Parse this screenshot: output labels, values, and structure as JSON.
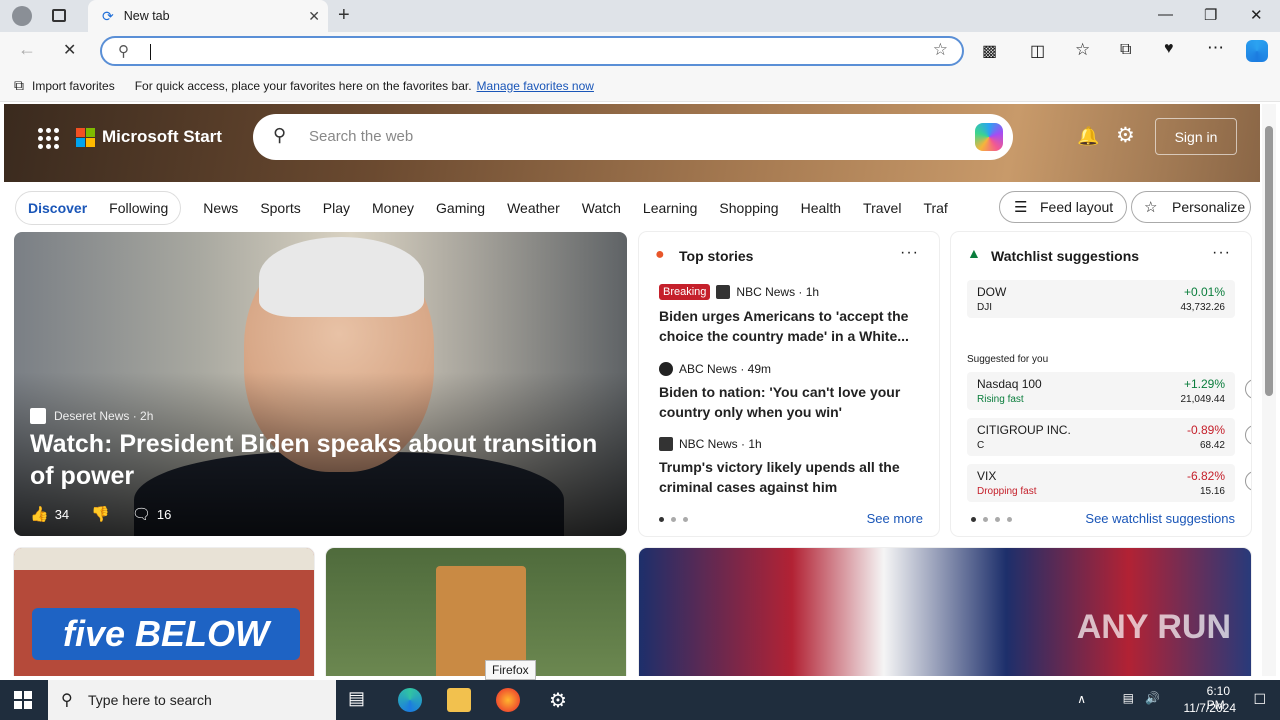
{
  "browser": {
    "tab_title": "New tab",
    "address_value": "",
    "fav_import": "Import favorites",
    "fav_hint": "For quick access, place your favorites here on the favorites bar.",
    "fav_manage": "Manage favorites now"
  },
  "header": {
    "brand": "Microsoft Start",
    "search_placeholder": "Search the web",
    "sign_in": "Sign in"
  },
  "nav": {
    "discover": "Discover",
    "following": "Following",
    "items": [
      "News",
      "Sports",
      "Play",
      "Money",
      "Gaming",
      "Weather",
      "Watch",
      "Learning",
      "Shopping",
      "Health",
      "Travel",
      "Traf"
    ],
    "feed_layout": "Feed layout",
    "personalize": "Personalize"
  },
  "main_story": {
    "source": "Deseret News · 2h",
    "title": "Watch: President Biden speaks about transition of power",
    "likes": "34",
    "comments": "16"
  },
  "top_stories": {
    "title": "Top stories",
    "items": [
      {
        "badge": "Breaking",
        "source": "NBC News · 1h",
        "title": "Biden urges Americans to 'accept the choice the country made' in a White..."
      },
      {
        "source": "ABC News · 49m",
        "title": "Biden to nation: 'You can't love your country only when you win'"
      },
      {
        "source": "NBC News · 1h",
        "title": "Trump's victory likely upends all the criminal cases against him"
      }
    ],
    "see_more": "See more"
  },
  "watchlist": {
    "title": "Watchlist suggestions",
    "suggested_label": "Suggested for you",
    "see_all": "See watchlist suggestions",
    "stocks": [
      {
        "name": "DOW",
        "sub": "DJI",
        "change": "+0.01%",
        "price": "43,732.26",
        "color": "#0a7d3c"
      },
      {
        "name": "Nasdaq 100",
        "sub": "Rising fast",
        "change": "+1.29%",
        "price": "21,049.44",
        "color": "#0a7d3c"
      },
      {
        "name": "CITIGROUP INC.",
        "sub": "C",
        "change": "-0.89%",
        "price": "68.42",
        "color": "#c5202b"
      },
      {
        "name": "VIX",
        "sub": "Dropping fast",
        "change": "-6.82%",
        "price": "15.16",
        "color": "#c5202b"
      }
    ]
  },
  "bottom_cards": {
    "five_below_sign": "five BELOW",
    "watermark": "ANY RUN"
  },
  "taskbar": {
    "search_placeholder": "Type here to search",
    "time": "6:10 PM",
    "date": "11/7/2024",
    "tooltip": "Firefox"
  },
  "colors": {
    "accent": "#1a56b8",
    "up": "#0a7d3c",
    "down": "#c5202b",
    "breaking": "#c5202b"
  }
}
